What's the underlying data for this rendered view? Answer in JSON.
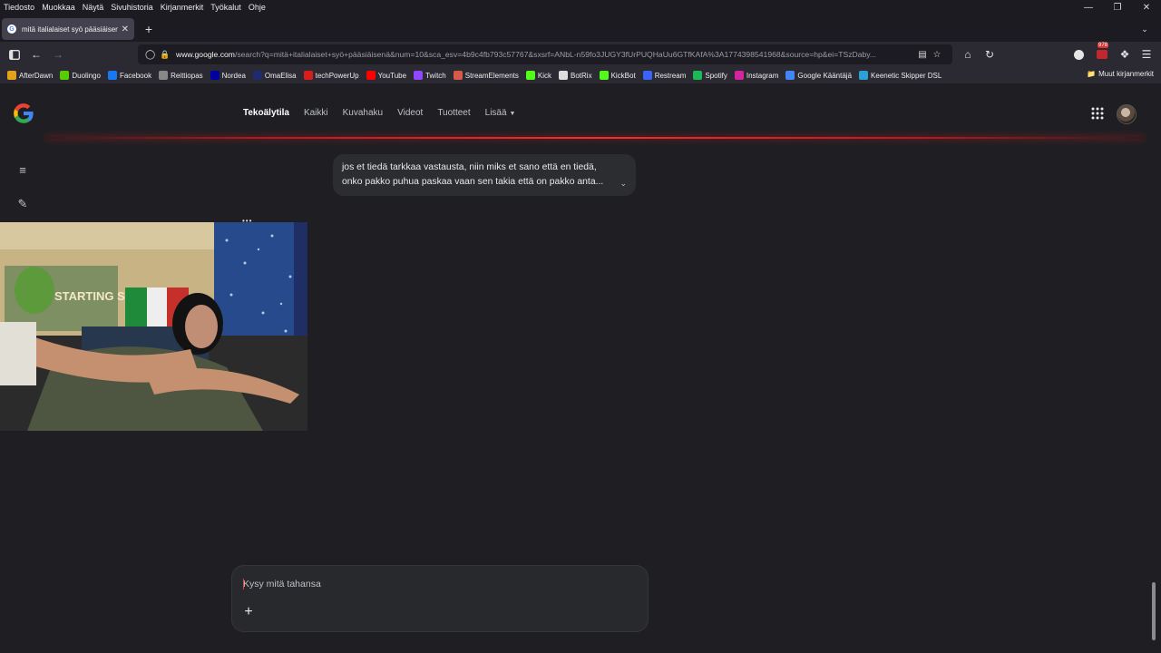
{
  "browser": {
    "menu": [
      "Tiedosto",
      "Muokkaa",
      "Näytä",
      "Sivuhistoria",
      "Kirjanmerkit",
      "Työkalut",
      "Ohje"
    ],
    "tab_title": "mitä italialaiset syö pääsiäisenä",
    "url_host": "www.google.com",
    "url_rest": "/search?q=mitä+italialaiset+syö+pääsiäisenä&num=10&sca_esv=4b9c4fb793c57767&sxsrf=ANbL-n59fo3JUGY3fUrPUQHaUu6GTfKAfA%3A1774398541968&source=hp&ei=TSzDaby...",
    "extension_badge": "978",
    "bookmarks": [
      {
        "label": "AfterDawn",
        "color": "#e4a21c"
      },
      {
        "label": "Duolingo",
        "color": "#58cc02"
      },
      {
        "label": "Facebook",
        "color": "#1877f2"
      },
      {
        "label": "Reittiopas",
        "color": "#888888"
      },
      {
        "label": "Nordea",
        "color": "#0000a0"
      },
      {
        "label": "OmaElisa",
        "color": "#1d2b6f"
      },
      {
        "label": "techPowerUp",
        "color": "#d81d1d"
      },
      {
        "label": "YouTube",
        "color": "#ff0000"
      },
      {
        "label": "Twitch",
        "color": "#9146ff"
      },
      {
        "label": "StreamElements",
        "color": "#d65a47"
      },
      {
        "label": "Kick",
        "color": "#53fc18"
      },
      {
        "label": "BotRix",
        "color": "#dddddd"
      },
      {
        "label": "KickBot",
        "color": "#53fc18"
      },
      {
        "label": "Restream",
        "color": "#3a64f6"
      },
      {
        "label": "Spotify",
        "color": "#1db954"
      },
      {
        "label": "Instagram",
        "color": "#d6249f"
      },
      {
        "label": "Google Kääntäjä",
        "color": "#4285f4"
      },
      {
        "label": "Keenetic Skipper DSL",
        "color": "#2aa0d8"
      }
    ],
    "other_bookmarks": "Muut kirjanmerkit"
  },
  "google": {
    "tabs": [
      "Tekoälytila",
      "Kaikki",
      "Kuvahaku",
      "Videot",
      "Tuotteet",
      "Lisää"
    ],
    "user_message": {
      "line1": "jos et tiedä tarkkaa vastausta, niin miks et sano että en tiedä,",
      "line2": "onko pakko puhua paskaa vaan sen takia että on pakko anta..."
    },
    "composer_placeholder": "Kysy mitä tahansa"
  },
  "webcam": {
    "poster_text": "STARTING SOON"
  },
  "colors": {
    "accent_glow": "#ff2a2a",
    "page_bg": "#1f1f23"
  }
}
